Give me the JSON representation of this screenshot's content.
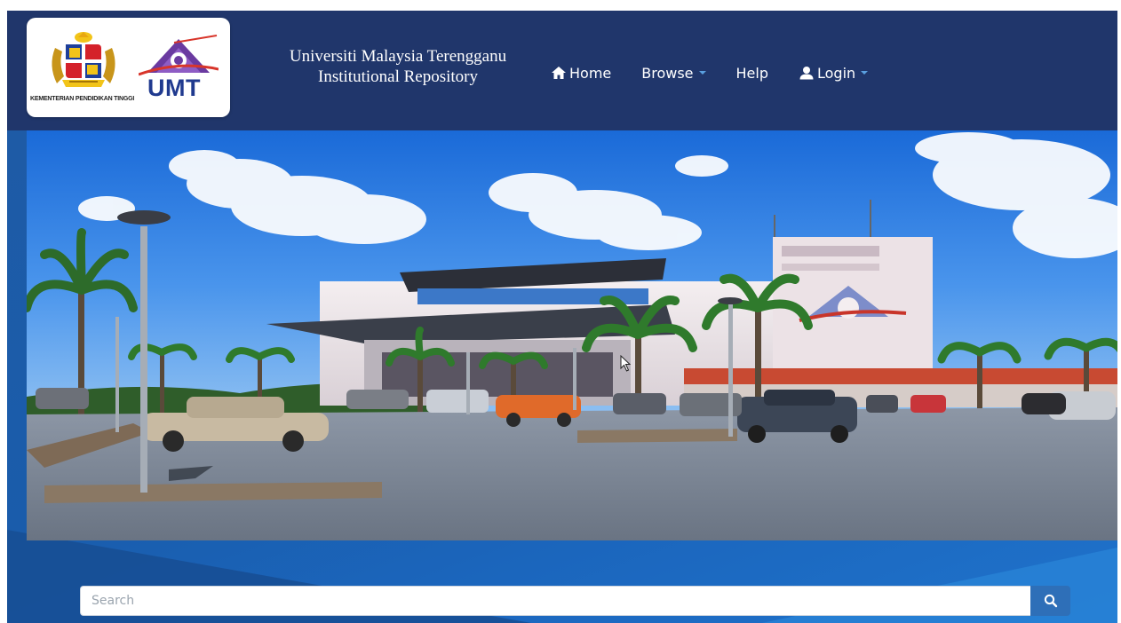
{
  "header": {
    "ministry_caption": "KEMENTERIAN PENDIDIKAN TINGGI",
    "umt_logo_text": "UMT",
    "site_title_line1": "Universiti Malaysia Terengganu",
    "site_title_line2": "Institutional Repository",
    "colors": {
      "navbar": "#20366b",
      "caret": "#5aa0e0"
    }
  },
  "nav": {
    "items": [
      {
        "label": "Home",
        "icon": "home-icon",
        "has_dropdown": false
      },
      {
        "label": "Browse",
        "icon": "",
        "has_dropdown": true
      },
      {
        "label": "Help",
        "icon": "",
        "has_dropdown": false
      },
      {
        "label": "Login",
        "icon": "user-icon",
        "has_dropdown": true
      }
    ]
  },
  "hero": {
    "image": "campus-building-photo"
  },
  "search": {
    "placeholder": "Search",
    "value": "",
    "button_icon": "search-icon"
  }
}
